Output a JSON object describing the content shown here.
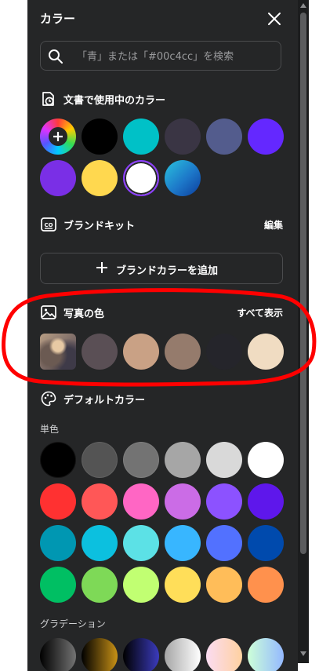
{
  "panel": {
    "title": "カラー",
    "search_placeholder": "「青」または「#00c4cc」を検索"
  },
  "document_colors": {
    "label": "文書で使用中のカラー",
    "swatches": [
      {
        "name": "add-color",
        "color": "rainbow"
      },
      {
        "name": "black",
        "color": "#000000"
      },
      {
        "name": "turquoise",
        "color": "#00c1c7"
      },
      {
        "name": "dark-slate",
        "color": "#3a3544"
      },
      {
        "name": "slate-blue",
        "color": "#535c8d"
      },
      {
        "name": "violet",
        "color": "#6428ff"
      },
      {
        "name": "purple",
        "color": "#7a2fe6"
      },
      {
        "name": "yellow",
        "color": "#ffd84f"
      },
      {
        "name": "white-selected",
        "color": "#ffffff"
      },
      {
        "name": "teal-blue-gradient",
        "color": "gradient"
      }
    ]
  },
  "brand_kit": {
    "label": "ブランドキット",
    "edit_label": "編集",
    "add_button_label": "ブランドカラーを追加"
  },
  "photo_colors": {
    "label": "写真の色",
    "show_all_label": "すべて表示",
    "swatches": [
      "#5a4f55",
      "#c9a185",
      "#957b6c",
      "#25252b",
      "#f0dcc2"
    ]
  },
  "default_colors": {
    "label": "デフォルトカラー",
    "solid_label": "単色",
    "gradient_label": "グラデーション",
    "solid_rows": [
      [
        "#000000",
        "#545454",
        "#737373",
        "#a6a6a6",
        "#d9d9d9",
        "#ffffff"
      ],
      [
        "#ff3131",
        "#ff5757",
        "#ff66c4",
        "#cb6ce6",
        "#8c52ff",
        "#5e17eb"
      ],
      [
        "#0097b2",
        "#0cc0df",
        "#5ce1e6",
        "#38b6ff",
        "#5271ff",
        "#004aad"
      ],
      [
        "#00bf63",
        "#7ed957",
        "#c1ff72",
        "#ffde59",
        "#ffbd59",
        "#ff914d"
      ]
    ]
  },
  "colors": {
    "panel_bg": "#252627",
    "highlight_outline": "#ff0000",
    "selected_ring": "#8b3dff"
  }
}
